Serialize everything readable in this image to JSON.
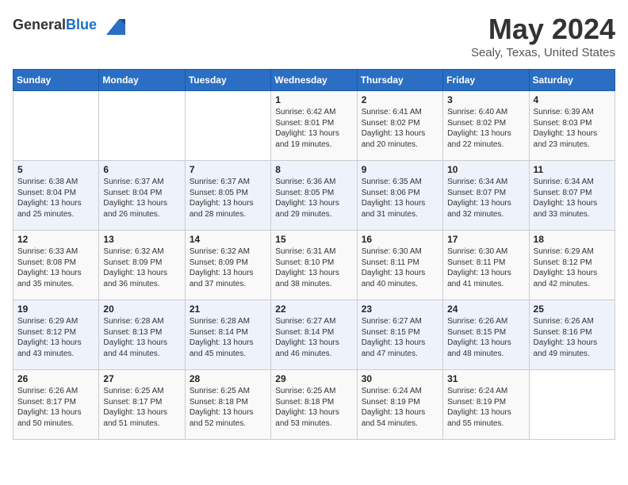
{
  "header": {
    "logo_general": "General",
    "logo_blue": "Blue",
    "month": "May 2024",
    "location": "Sealy, Texas, United States"
  },
  "weekdays": [
    "Sunday",
    "Monday",
    "Tuesday",
    "Wednesday",
    "Thursday",
    "Friday",
    "Saturday"
  ],
  "weeks": [
    [
      {
        "day": "",
        "info": ""
      },
      {
        "day": "",
        "info": ""
      },
      {
        "day": "",
        "info": ""
      },
      {
        "day": "1",
        "info": "Sunrise: 6:42 AM\nSunset: 8:01 PM\nDaylight: 13 hours and 19 minutes."
      },
      {
        "day": "2",
        "info": "Sunrise: 6:41 AM\nSunset: 8:02 PM\nDaylight: 13 hours and 20 minutes."
      },
      {
        "day": "3",
        "info": "Sunrise: 6:40 AM\nSunset: 8:02 PM\nDaylight: 13 hours and 22 minutes."
      },
      {
        "day": "4",
        "info": "Sunrise: 6:39 AM\nSunset: 8:03 PM\nDaylight: 13 hours and 23 minutes."
      }
    ],
    [
      {
        "day": "5",
        "info": "Sunrise: 6:38 AM\nSunset: 8:04 PM\nDaylight: 13 hours and 25 minutes."
      },
      {
        "day": "6",
        "info": "Sunrise: 6:37 AM\nSunset: 8:04 PM\nDaylight: 13 hours and 26 minutes."
      },
      {
        "day": "7",
        "info": "Sunrise: 6:37 AM\nSunset: 8:05 PM\nDaylight: 13 hours and 28 minutes."
      },
      {
        "day": "8",
        "info": "Sunrise: 6:36 AM\nSunset: 8:05 PM\nDaylight: 13 hours and 29 minutes."
      },
      {
        "day": "9",
        "info": "Sunrise: 6:35 AM\nSunset: 8:06 PM\nDaylight: 13 hours and 31 minutes."
      },
      {
        "day": "10",
        "info": "Sunrise: 6:34 AM\nSunset: 8:07 PM\nDaylight: 13 hours and 32 minutes."
      },
      {
        "day": "11",
        "info": "Sunrise: 6:34 AM\nSunset: 8:07 PM\nDaylight: 13 hours and 33 minutes."
      }
    ],
    [
      {
        "day": "12",
        "info": "Sunrise: 6:33 AM\nSunset: 8:08 PM\nDaylight: 13 hours and 35 minutes."
      },
      {
        "day": "13",
        "info": "Sunrise: 6:32 AM\nSunset: 8:09 PM\nDaylight: 13 hours and 36 minutes."
      },
      {
        "day": "14",
        "info": "Sunrise: 6:32 AM\nSunset: 8:09 PM\nDaylight: 13 hours and 37 minutes."
      },
      {
        "day": "15",
        "info": "Sunrise: 6:31 AM\nSunset: 8:10 PM\nDaylight: 13 hours and 38 minutes."
      },
      {
        "day": "16",
        "info": "Sunrise: 6:30 AM\nSunset: 8:11 PM\nDaylight: 13 hours and 40 minutes."
      },
      {
        "day": "17",
        "info": "Sunrise: 6:30 AM\nSunset: 8:11 PM\nDaylight: 13 hours and 41 minutes."
      },
      {
        "day": "18",
        "info": "Sunrise: 6:29 AM\nSunset: 8:12 PM\nDaylight: 13 hours and 42 minutes."
      }
    ],
    [
      {
        "day": "19",
        "info": "Sunrise: 6:29 AM\nSunset: 8:12 PM\nDaylight: 13 hours and 43 minutes."
      },
      {
        "day": "20",
        "info": "Sunrise: 6:28 AM\nSunset: 8:13 PM\nDaylight: 13 hours and 44 minutes."
      },
      {
        "day": "21",
        "info": "Sunrise: 6:28 AM\nSunset: 8:14 PM\nDaylight: 13 hours and 45 minutes."
      },
      {
        "day": "22",
        "info": "Sunrise: 6:27 AM\nSunset: 8:14 PM\nDaylight: 13 hours and 46 minutes."
      },
      {
        "day": "23",
        "info": "Sunrise: 6:27 AM\nSunset: 8:15 PM\nDaylight: 13 hours and 47 minutes."
      },
      {
        "day": "24",
        "info": "Sunrise: 6:26 AM\nSunset: 8:15 PM\nDaylight: 13 hours and 48 minutes."
      },
      {
        "day": "25",
        "info": "Sunrise: 6:26 AM\nSunset: 8:16 PM\nDaylight: 13 hours and 49 minutes."
      }
    ],
    [
      {
        "day": "26",
        "info": "Sunrise: 6:26 AM\nSunset: 8:17 PM\nDaylight: 13 hours and 50 minutes."
      },
      {
        "day": "27",
        "info": "Sunrise: 6:25 AM\nSunset: 8:17 PM\nDaylight: 13 hours and 51 minutes."
      },
      {
        "day": "28",
        "info": "Sunrise: 6:25 AM\nSunset: 8:18 PM\nDaylight: 13 hours and 52 minutes."
      },
      {
        "day": "29",
        "info": "Sunrise: 6:25 AM\nSunset: 8:18 PM\nDaylight: 13 hours and 53 minutes."
      },
      {
        "day": "30",
        "info": "Sunrise: 6:24 AM\nSunset: 8:19 PM\nDaylight: 13 hours and 54 minutes."
      },
      {
        "day": "31",
        "info": "Sunrise: 6:24 AM\nSunset: 8:19 PM\nDaylight: 13 hours and 55 minutes."
      },
      {
        "day": "",
        "info": ""
      }
    ]
  ]
}
